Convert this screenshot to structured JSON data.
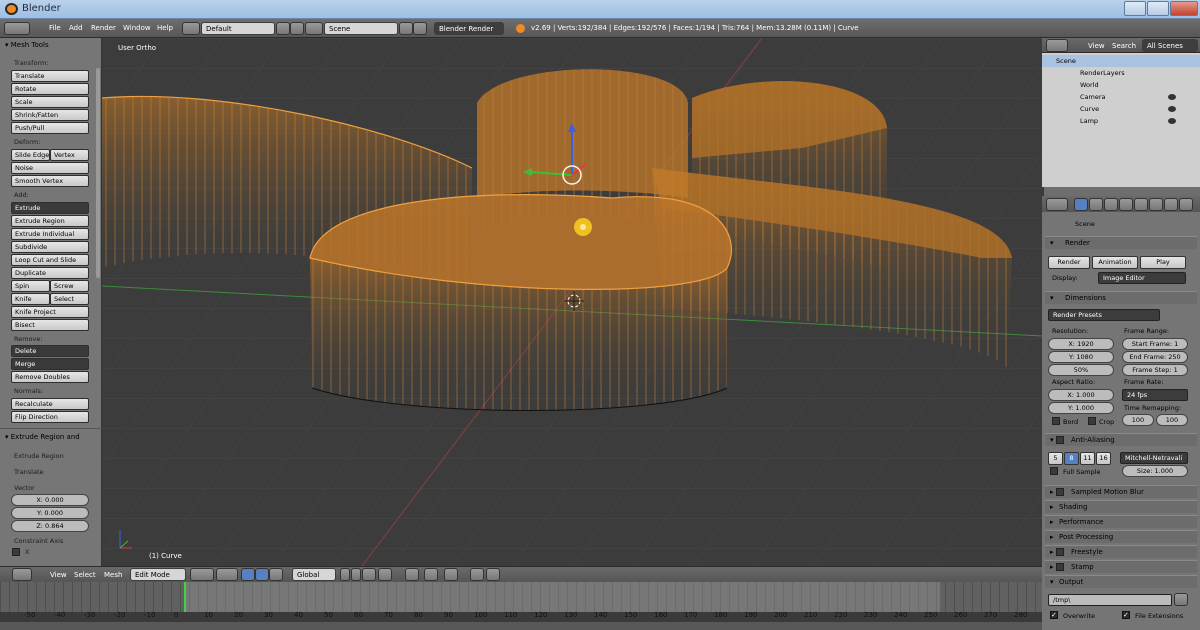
{
  "window": {
    "title": "Blender"
  },
  "info_header": {
    "menus": [
      "File",
      "Add",
      "Render",
      "Window",
      "Help"
    ],
    "screen_layout": "Default",
    "scene": "Scene",
    "render_engine": "Blender Render",
    "stats": "v2.69 | Verts:192/384 | Edges:192/576 | Faces:1/194 | Tris:764 | Mem:13.28M (0.11M) | Curve"
  },
  "tool_shelf": {
    "title": "Mesh Tools",
    "transform_label": "Transform:",
    "transform": [
      "Translate",
      "Rotate",
      "Scale",
      "Shrink/Fatten",
      "Push/Pull"
    ],
    "deform_label": "Deform:",
    "deform_slide_edge": "Slide Edge",
    "deform_vertex": "Vertex",
    "deform_noise": "Noise",
    "deform_smooth": "Smooth Vertex",
    "add_label": "Add:",
    "extrude": "Extrude",
    "add_items": [
      "Extrude Region",
      "Extrude Individual",
      "Subdivide",
      "Loop Cut and Slide",
      "Duplicate"
    ],
    "spin": "Spin",
    "screw": "Screw",
    "knife": "Knife",
    "select": "Select",
    "knife_project": "Knife Project",
    "bisect": "Bisect",
    "remove_label": "Remove:",
    "delete": "Delete",
    "merge": "Merge",
    "remove_doubles": "Remove Doubles",
    "normals_label": "Normals:",
    "recalculate": "Recalculate",
    "flip_direction": "Flip Direction",
    "operator_title": "Extrude Region and",
    "op_extrude_region": "Extrude Region",
    "op_translate": "Translate",
    "vector_label": "Vector",
    "vector": [
      "X: 0.000",
      "Y: 0.000",
      "Z: 0.864"
    ],
    "constraint_label": "Constraint Axis",
    "constraint_x": "X"
  },
  "viewport": {
    "view_label": "User Ortho",
    "object_label": "(1) Curve"
  },
  "viewport_header": {
    "menus": [
      "View",
      "Select",
      "Mesh"
    ],
    "mode": "Edit Mode",
    "orientation": "Global"
  },
  "timeline": {
    "ticks": [
      "-50",
      "-40",
      "-30",
      "-20",
      "-10",
      "0",
      "10",
      "20",
      "30",
      "40",
      "50",
      "60",
      "70",
      "80",
      "90",
      "100",
      "110",
      "120",
      "130",
      "140",
      "150",
      "160",
      "170",
      "180",
      "190",
      "200",
      "210",
      "220",
      "230",
      "240",
      "250",
      "260",
      "270",
      "280"
    ]
  },
  "outliner": {
    "menus": [
      "View",
      "Search",
      "All Scenes"
    ],
    "items": [
      "Scene",
      "RenderLayers",
      "World",
      "Camera",
      "Curve",
      "Lamp"
    ]
  },
  "properties": {
    "scene_label": "Scene",
    "render_panel": "Render",
    "render_btn": "Render",
    "animation_btn": "Animation",
    "play_btn": "Play",
    "display_label": "Display:",
    "display_value": "Image Editor",
    "dimensions_panel": "Dimensions",
    "render_presets": "Render Presets",
    "resolution_label": "Resolution:",
    "res_x": "X: 1920",
    "res_y": "Y: 1080",
    "res_pct": "50%",
    "frame_range_label": "Frame Range:",
    "start_frame": "Start Frame: 1",
    "end_frame": "End Frame: 250",
    "frame_step": "Frame Step: 1",
    "aspect_label": "Aspect Ratio:",
    "aspect_x": "X: 1.000",
    "aspect_y": "Y: 1.000",
    "frame_rate_label": "Frame Rate:",
    "frame_rate": "24 fps",
    "time_remap_label": "Time Remapping:",
    "remap_old": "100",
    "remap_new": "100",
    "bord": "Bord",
    "crop": "Crop",
    "aa_panel": "Anti-Aliasing",
    "aa_samples": [
      "5",
      "8",
      "11",
      "16"
    ],
    "aa_filter": "Mitchell-Netravali",
    "full_sample": "Full Sample",
    "aa_size": "Size: 1.000",
    "collapsed": [
      "Sampled Motion Blur",
      "Shading",
      "Performance",
      "Post Processing",
      "Freestyle",
      "Stamp"
    ],
    "output_panel": "Output",
    "output_path": "/tmp\\",
    "overwrite": "Overwrite",
    "file_extensions": "File Extensions"
  },
  "colors": {
    "mesh_orange": "#e8902a",
    "timeline_cursor": "#3fd43f",
    "accent_blue": "#5680c2"
  }
}
